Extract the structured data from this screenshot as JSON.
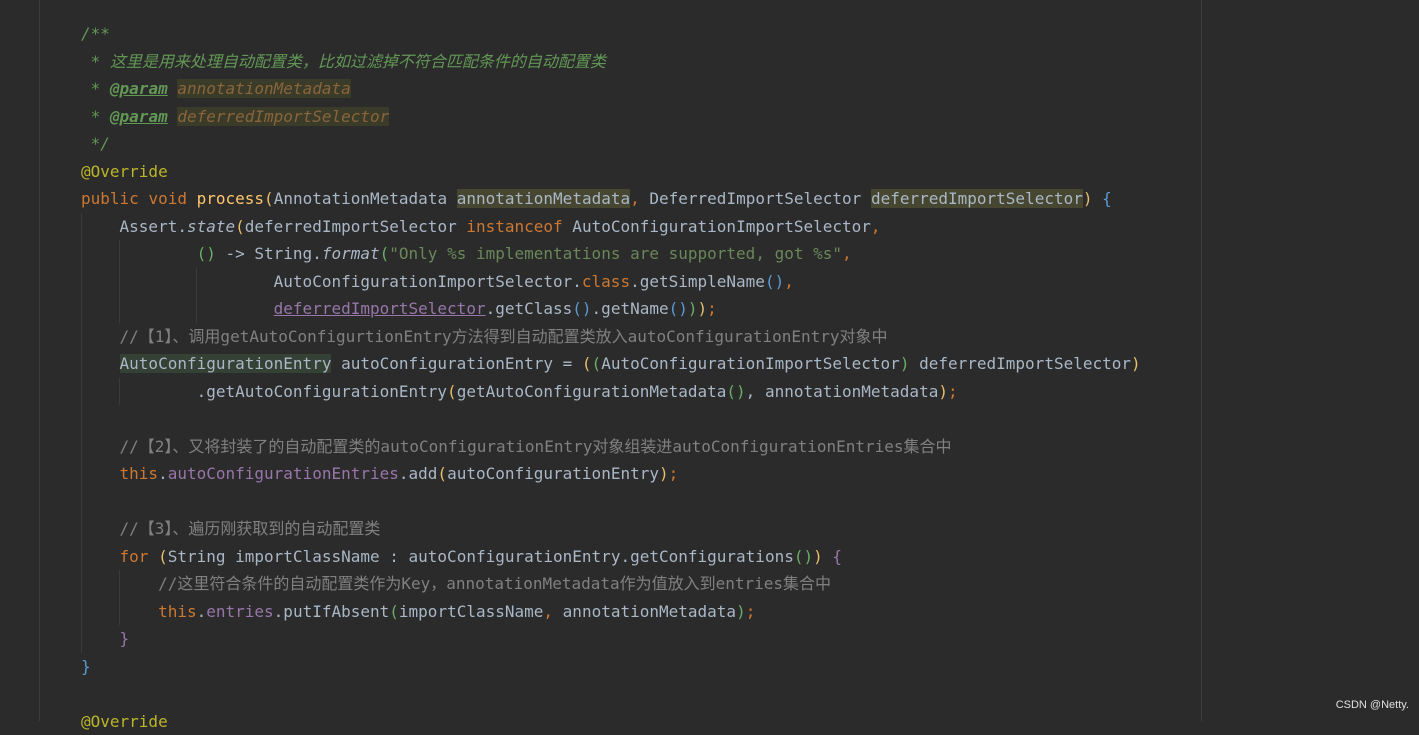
{
  "code": {
    "l1": "/**",
    "l2": " * 这里是用来处理自动配置类，比如过滤掉不符合匹配条件的自动配置类",
    "l3_star": " * ",
    "l3_tag": "@param",
    "l3_val": "annotationMetadata",
    "l4_star": " * ",
    "l4_tag": "@param",
    "l4_val": "deferredImportSelector",
    "l5": " */",
    "l6": "@Override",
    "l7_public": "public",
    "l7_void": "void",
    "l7_method": "process",
    "l7_p1": "(",
    "l7_type1": "AnnotationMetadata ",
    "l7_arg1": "annotationMetadata",
    "l7_comma": ", ",
    "l7_type2": "DeferredImportSelector ",
    "l7_arg2": "deferredImportSelector",
    "l7_p2": ")",
    "l7_brace": "{",
    "l8_cls": "Assert.",
    "l8_m": "state",
    "l8_p": "(",
    "l8_a": "deferredImportSelector ",
    "l8_kw": "instanceof",
    "l8_b": " AutoConfigurationImportSelector",
    "l8_c": ",",
    "l9_lam": "()",
    "l9_arrow": " -> String.",
    "l9_m": "format",
    "l9_p": "(",
    "l9_str": "\"Only %s implementations are supported, got %s\"",
    "l9_c": ",",
    "l10_a": "AutoConfigurationImportSelector.",
    "l10_kw": "class",
    "l10_b": ".getSimpleName",
    "l10_p": "()",
    "l10_c": ",",
    "l11_a": "deferredImportSelector",
    "l11_b": ".getClass",
    "l11_p1": "()",
    "l11_c": ".getName",
    "l11_p2": "()",
    "l11_p3": ")",
    "l11_p4": ")",
    "l11_end": ";",
    "l12": "//【1】、调用getAutoConfigurtionEntry方法得到自动配置类放入autoConfigurationEntry对象中",
    "l13_type": "AutoConfigurationEntry",
    "l13_a": " autoConfigurationEntry = ",
    "l13_p1": "(",
    "l13_p2": "(",
    "l13_cast": "AutoConfigurationImportSelector",
    "l13_p3": ")",
    "l13_b": " deferredImportSelector",
    "l13_p4": ")",
    "l14_a": ".getAutoConfigurationEntry",
    "l14_p1": "(",
    "l14_b": "getAutoConfigurationMetadata",
    "l14_p2": "()",
    "l14_c": ", annotationMetadata",
    "l14_p3": ")",
    "l14_end": ";",
    "l16": "//【2】、又将封装了的自动配置类的autoConfigurationEntry对象组装进autoConfigurationEntries集合中",
    "l17_this": "this",
    "l17_dot": ".",
    "l17_fld": "autoConfigurationEntries",
    "l17_a": ".add",
    "l17_p1": "(",
    "l17_b": "autoConfigurationEntry",
    "l17_p2": ")",
    "l17_end": ";",
    "l19": "//【3】、遍历刚获取到的自动配置类",
    "l20_for": "for",
    "l20_p1": " (",
    "l20_a": "String importClassName : autoConfigurationEntry.getConfigurations",
    "l20_p2": "()",
    "l20_p3": ")",
    "l20_brace": " {",
    "l21": "//这里符合条件的自动配置类作为Key，annotationMetadata作为值放入到entries集合中",
    "l22_this": "this",
    "l22_dot": ".",
    "l22_fld": "entries",
    "l22_a": ".putIfAbsent",
    "l22_p1": "(",
    "l22_b": "importClassName",
    "l22_c": ", ",
    "l22_d": "annotationMetadata",
    "l22_p2": ")",
    "l22_end": ";",
    "l23": "}",
    "l24": "}",
    "l26": "@Override"
  },
  "watermark": "CSDN @Netty."
}
